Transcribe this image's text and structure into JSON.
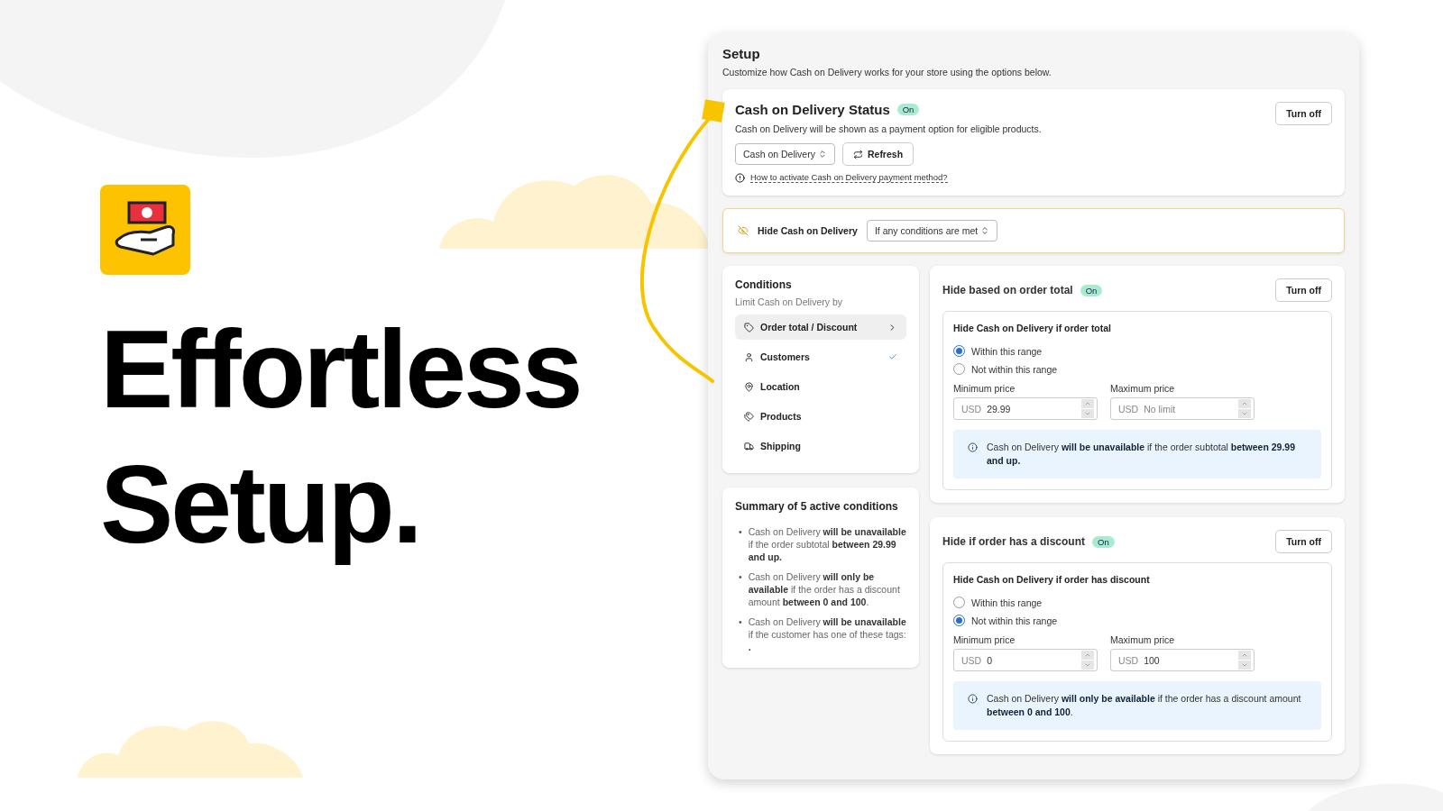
{
  "headline_lines": [
    "Effortless",
    "Setup."
  ],
  "setup": {
    "title": "Setup",
    "subtitle": "Customize how Cash on Delivery works for your store using the options below."
  },
  "status_card": {
    "title": "Cash on Delivery Status",
    "badge": "On",
    "description": "Cash on Delivery will be shown as a payment option for eligible products.",
    "button": "Turn off",
    "select": "Cash on Delivery",
    "refresh": "Refresh",
    "help_link": "How to activate Cash on Delivery payment method?"
  },
  "hide_bar": {
    "label": "Hide Cash on Delivery",
    "select": "If any conditions are met"
  },
  "conditions": {
    "title": "Conditions",
    "subtitle": "Limit Cash on Delivery by",
    "items": [
      {
        "label": "Order total / Discount",
        "selected": true,
        "checked": false
      },
      {
        "label": "Customers",
        "selected": false,
        "checked": true
      },
      {
        "label": "Location",
        "selected": false,
        "checked": false
      },
      {
        "label": "Products",
        "selected": false,
        "checked": false
      },
      {
        "label": "Shipping",
        "selected": false,
        "checked": false
      }
    ]
  },
  "summary": {
    "title": "Summary of 5 active conditions",
    "items": [
      {
        "marker": "•",
        "text": "Cash on Delivery **will be unavailable** if the order subtotal **between 29.99 and up.**"
      },
      {
        "marker": "•",
        "text": "Cash on Delivery **will only be available** if the order has a discount amount **between 0 and 100**."
      },
      {
        "marker": "•",
        "text": "Cash on Delivery **will be unavailable** if the customer has one of these tags: **.**"
      }
    ]
  },
  "rules": [
    {
      "title": "Hide based on order total",
      "badge": "On",
      "button": "Turn off",
      "box_title": "Hide Cash on Delivery if order total",
      "options": [
        {
          "label": "Within this range",
          "selected": true
        },
        {
          "label": "Not within this range",
          "selected": false
        }
      ],
      "min": {
        "label": "Minimum price",
        "currency": "USD",
        "value": "29.99"
      },
      "max": {
        "label": "Maximum price",
        "currency": "USD",
        "placeholder": "No limit"
      },
      "info": "Cash on Delivery **will be unavailable** if the order subtotal **between 29.99 and up.**"
    },
    {
      "title": "Hide if order has a discount",
      "badge": "On",
      "button": "Turn off",
      "box_title": "Hide Cash on Delivery if order has discount",
      "options": [
        {
          "label": "Within this range",
          "selected": false
        },
        {
          "label": "Not within this range",
          "selected": true
        }
      ],
      "min": {
        "label": "Minimum price",
        "currency": "USD",
        "value": "0"
      },
      "max": {
        "label": "Maximum price",
        "currency": "USD",
        "value": "100"
      },
      "info": "Cash on Delivery **will only be available** if the order has a discount amount **between 0 and 100**."
    }
  ]
}
